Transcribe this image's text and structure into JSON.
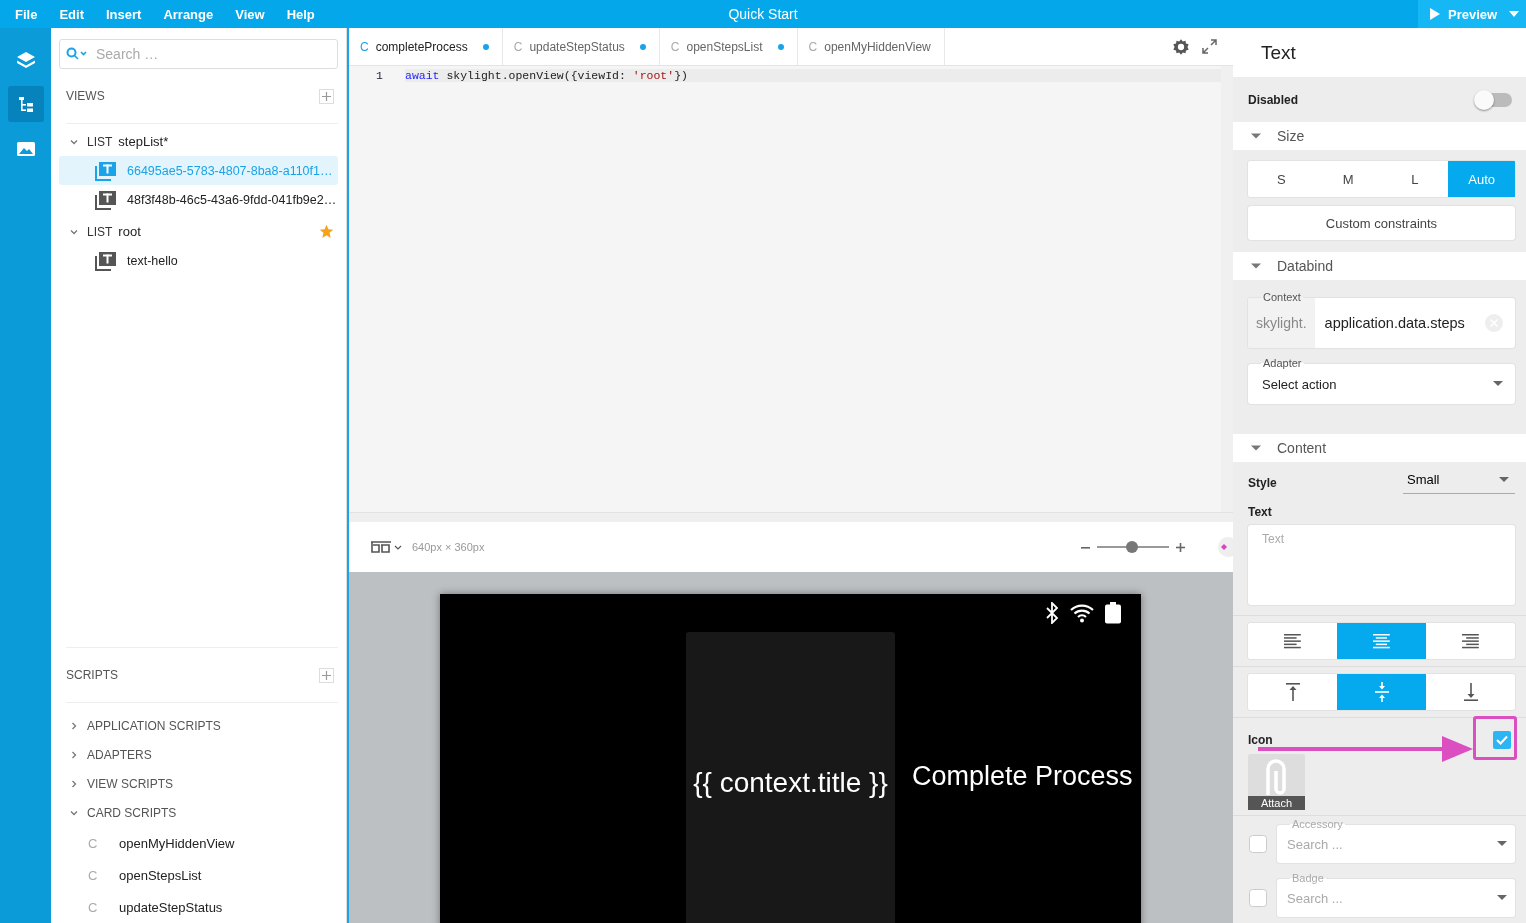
{
  "menu": [
    "File",
    "Edit",
    "Insert",
    "Arrange",
    "View",
    "Help"
  ],
  "title": "Quick Start",
  "preview_button": "Preview",
  "rail": [
    {
      "kind": "layers",
      "selected": false
    },
    {
      "kind": "tree",
      "selected": true
    },
    {
      "kind": "image",
      "selected": false
    }
  ],
  "explorer": {
    "search_placeholder": "Search …",
    "views": {
      "heading": "VIEWS",
      "tree": [
        {
          "type": "LIST",
          "label": "stepList*",
          "expanded": true,
          "starred": false,
          "children": [
            {
              "label": "66495ae5-5783-4807-8ba8-a110f1…",
              "selected": true
            },
            {
              "label": "48f3f48b-46c5-43a6-9fdd-041fb9e2…",
              "selected": false
            }
          ]
        },
        {
          "type": "LIST",
          "label": "root",
          "expanded": true,
          "starred": true,
          "children": [
            {
              "label": "text-hello",
              "selected": false
            }
          ]
        }
      ]
    },
    "scripts": {
      "heading": "SCRIPTS",
      "groups": [
        {
          "label": "APPLICATION SCRIPTS",
          "expanded": false
        },
        {
          "label": "ADAPTERS",
          "expanded": false
        },
        {
          "label": "VIEW SCRIPTS",
          "expanded": false
        },
        {
          "label": "CARD SCRIPTS",
          "expanded": true,
          "children": [
            {
              "prefix": "C",
              "label": "openMyHiddenView"
            },
            {
              "prefix": "C",
              "label": "openStepsList"
            },
            {
              "prefix": "C",
              "label": "updateStepStatus"
            }
          ]
        }
      ]
    }
  },
  "tabs": [
    {
      "prefix": "C",
      "label": "completeProcess",
      "selected": true,
      "modified": true
    },
    {
      "prefix": "C",
      "label": "updateStepStatus",
      "selected": false,
      "modified": true
    },
    {
      "prefix": "C",
      "label": "openStepsList",
      "selected": false,
      "modified": true
    },
    {
      "prefix": "C",
      "label": "openMyHiddenView",
      "selected": false,
      "modified": false
    }
  ],
  "code": [
    {
      "number": "1",
      "tokens": [
        {
          "kind": "keyword",
          "text": "await"
        },
        {
          "kind": "plain",
          "text": " skylight.openView({viewId: "
        },
        {
          "kind": "string",
          "text": "'root'"
        },
        {
          "kind": "plain",
          "text": "})"
        }
      ]
    }
  ],
  "preview": {
    "size_label": "640px × 360px",
    "zoom": {
      "level": 0.48
    },
    "card_text": "{{ context.title }}",
    "title_text": "Complete Process"
  },
  "inspector": {
    "title": "Text",
    "disabled": {
      "label": "Disabled",
      "on": false
    },
    "size": {
      "label": "Size",
      "expanded": true,
      "options": [
        {
          "label": "S",
          "selected": false
        },
        {
          "label": "M",
          "selected": false
        },
        {
          "label": "L",
          "selected": false
        },
        {
          "label": "Auto",
          "selected": true
        }
      ],
      "custom_button": "Custom constraints"
    },
    "databind": {
      "label": "Databind",
      "expanded": true,
      "context": {
        "label": "Context",
        "prefix": "skylight.",
        "value": "application.data.steps"
      },
      "adapter": {
        "label": "Adapter",
        "value": "Select action"
      }
    },
    "content": {
      "label": "Content",
      "expanded": true,
      "style": {
        "label": "Style",
        "value": "Small"
      },
      "text": {
        "label": "Text",
        "placeholder": "Text"
      },
      "h_align": [
        {
          "kind": "left",
          "selected": false
        },
        {
          "kind": "center",
          "selected": true
        },
        {
          "kind": "right",
          "selected": false
        }
      ],
      "v_align": [
        {
          "kind": "top",
          "selected": false
        },
        {
          "kind": "middle",
          "selected": true
        },
        {
          "kind": "bottom",
          "selected": false
        }
      ],
      "icon": {
        "label": "Icon",
        "checked": true,
        "tile_label": "Attach"
      },
      "accessory": {
        "label": "Accessory",
        "placeholder": "Search ...",
        "checked": false
      },
      "badge": {
        "label": "Badge",
        "placeholder": "Search ...",
        "checked": false
      }
    }
  }
}
